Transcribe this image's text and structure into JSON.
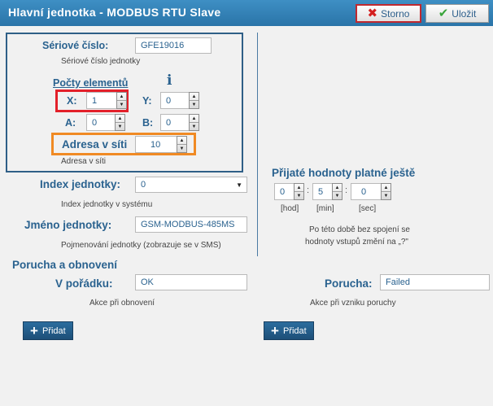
{
  "titlebar": {
    "title": "Hlavní jednotka - MODBUS RTU Slave",
    "cancel_label": "Storno",
    "save_label": "Uložit"
  },
  "icons": {
    "cancel": "x-icon",
    "save": "check-icon",
    "info": "info-icon",
    "add": "plus-icon"
  },
  "serial": {
    "label": "Sériové číslo:",
    "value": "GFE19016",
    "hint": "Sériové číslo jednotky"
  },
  "elements": {
    "heading": "Počty elementů",
    "info_glyph": "i",
    "x_label": "X:",
    "x_value": "1",
    "y_label": "Y:",
    "y_value": "0",
    "a_label": "A:",
    "a_value": "0",
    "b_label": "B:",
    "b_value": "0"
  },
  "address": {
    "label": "Adresa v síti",
    "value": "10",
    "hint": "Adresa v síti"
  },
  "index": {
    "label": "Index jednotky:",
    "value": "0",
    "hint": "Index jednotky v systému"
  },
  "name": {
    "label": "Jméno jednotky:",
    "value": "GSM-MODBUS-485MS",
    "hint": "Pojmenování jednotky (zobrazuje se v SMS)"
  },
  "validity": {
    "heading": "Přijaté hodnoty platné ještě",
    "hours": "0",
    "minutes": "5",
    "seconds": "0",
    "sep": ":",
    "hours_unit": "[hod]",
    "minutes_unit": "[min]",
    "seconds_unit": "[sec]",
    "note_line1": "Po této době bez spojení se",
    "note_line2": "hodnoty vstupů změní na „?\""
  },
  "fault": {
    "heading": "Porucha a obnovení",
    "ok_label": "V pořádku:",
    "ok_value": "OK",
    "ok_hint": "Akce při obnovení",
    "fault_label": "Porucha:",
    "fault_value": "Failed",
    "fault_hint": "Akce při vzniku poruchy",
    "add_label": "Přidat"
  }
}
